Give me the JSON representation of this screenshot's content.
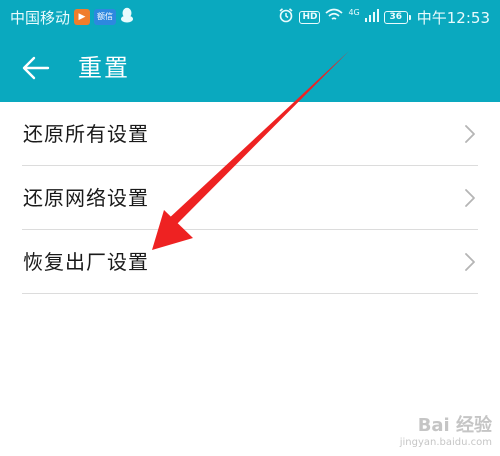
{
  "status_bar": {
    "carrier": "中国移动",
    "app_badges": [
      "play-icon",
      "message-app-icon",
      "qq-icon"
    ],
    "message_badge_text": "额信",
    "hd_label": "HD",
    "network_label": "4G",
    "battery_level": "36",
    "time": "中午12:53"
  },
  "app_bar": {
    "title": "重置",
    "back_icon": "arrow-left-icon"
  },
  "list": {
    "items": [
      {
        "label": "还原所有设置"
      },
      {
        "label": "还原网络设置"
      },
      {
        "label": "恢复出厂设置"
      }
    ]
  },
  "watermark": {
    "logo_text": "Bai 经验",
    "url": "jingyan.baidu.com"
  },
  "colors": {
    "accent": "#0aa9bf",
    "annotation_arrow": "#ee2222",
    "text": "#1a1a1a",
    "divider": "#dcdcdc"
  }
}
